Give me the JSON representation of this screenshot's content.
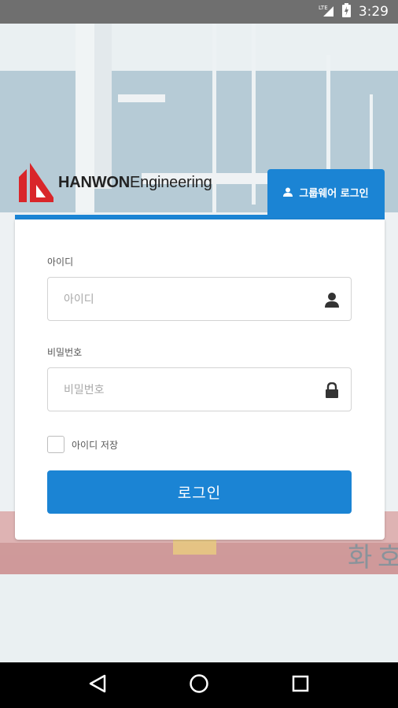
{
  "status_bar": {
    "network": "LTE",
    "time": "3:29"
  },
  "logo": {
    "brand_bold": "HANWON",
    "brand_rest": "Engineering"
  },
  "tab": {
    "label": "그룹웨어 로그인"
  },
  "form": {
    "id_label": "아이디",
    "id_placeholder": "아이디",
    "pw_label": "비밀번호",
    "pw_placeholder": "비밀번호",
    "remember_label": "아이디 저장",
    "login_button": "로그인"
  },
  "colors": {
    "accent": "#1b84d4",
    "logo_red": "#d9262a"
  },
  "icons": [
    "user-icon",
    "lock-icon",
    "back-icon",
    "home-icon",
    "recents-icon",
    "signal-icon",
    "battery-icon"
  ]
}
